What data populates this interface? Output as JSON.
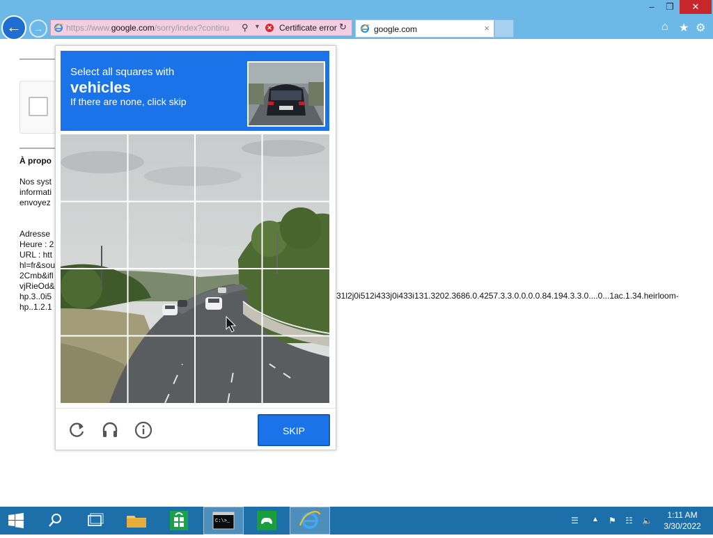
{
  "browser": {
    "window_controls": {
      "minimize": "–",
      "restore": "❐",
      "close": "✕"
    },
    "address_bar": {
      "url_prefix": "https://www.",
      "url_domain": "google.com",
      "url_rest": "/sorry/index?continu",
      "cert_error_label": "Certificate error"
    },
    "tab": {
      "label": "google.com",
      "close": "×"
    },
    "accent": "#6cb9e8"
  },
  "page": {
    "heading": "À propo",
    "body_lines": [
      "Nos syst",
      "informati",
      "envoyez"
    ],
    "detail_lines": [
      "Adresse",
      "Heure : 2",
      "URL : htt",
      "hl=fr&sou",
      "2Cmb&ifl",
      "vjRieOd&",
      "hp.3..0i5",
      "hp..1.2.1"
    ],
    "long_line": "31l2j0i512i433j0i433i131.3202.3686.0.4257.3.3.0.0.0.0.84.194.3.3.0....0...1ac.1.34.heirloom-"
  },
  "captcha": {
    "prompt_line1": "Select all squares with",
    "prompt_target": "vehicles",
    "prompt_line3": "If there are none, click skip",
    "skip_label": "SKIP",
    "grid_rows": 4,
    "grid_cols": 4,
    "accent": "#1a73e8"
  },
  "taskbar": {
    "clock_time": "1:11 AM",
    "clock_date": "3/30/2022",
    "color": "#1c6fa8"
  }
}
